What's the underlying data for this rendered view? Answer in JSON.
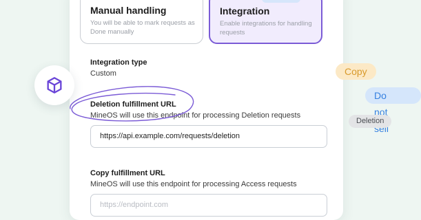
{
  "options": {
    "manual": {
      "title": "Manual handling",
      "desc": "You will be able to mark requests as Done manually"
    },
    "integration": {
      "title": "Integration",
      "desc": "Enable integrations for handling requests"
    }
  },
  "integration_type": {
    "label": "Integration type",
    "value": "Custom"
  },
  "deletion": {
    "label": "Deletion fulfillment URL",
    "desc": "MineOS will use this endpoint for processing Deletion requests",
    "value": "https://api.example.com/requests/deletion"
  },
  "copy": {
    "label": "Copy fulfillment URL",
    "desc": "MineOS will use this endpoint for processing Access requests",
    "placeholder": "https://endpoint.com"
  },
  "chips": {
    "copy": "Copy",
    "do_not_sell": "Do not sell",
    "deletion": "Deletion"
  },
  "colors": {
    "accent": "#7a5ad6",
    "background": "#eef6f2",
    "copy_chip": "#fce9c6",
    "dns_chip": "#d5e6fb"
  },
  "icons": {
    "badge": "cube-icon"
  }
}
